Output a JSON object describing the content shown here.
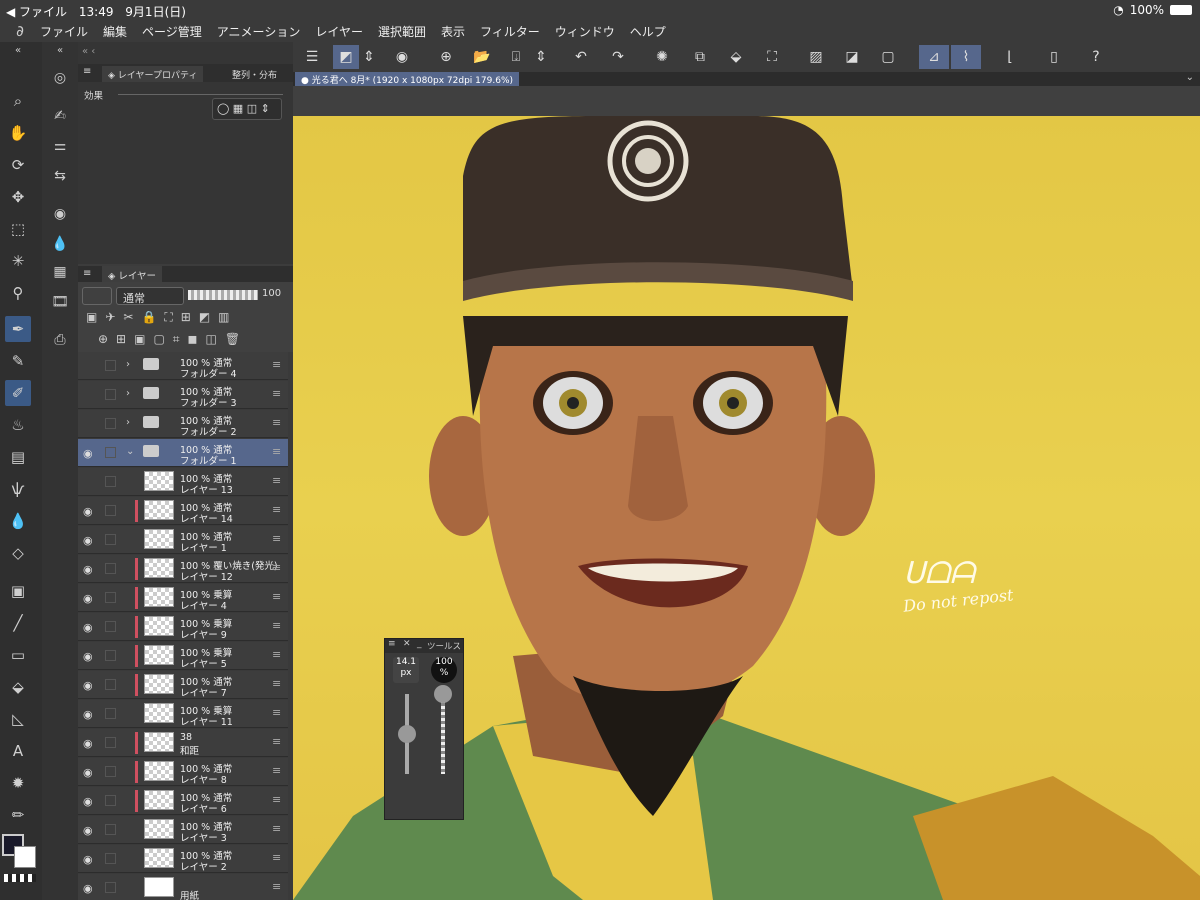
{
  "status": {
    "carrier": "◀ ファイル",
    "time": "13:49",
    "date": "9月1日(日)",
    "battery": "100%"
  },
  "menu": [
    "ファイル",
    "編集",
    "ページ管理",
    "アニメーション",
    "レイヤー",
    "選択範囲",
    "表示",
    "フィルター",
    "ウィンドウ",
    "ヘルプ"
  ],
  "property_panel": {
    "tab1": "レイヤープロパティ",
    "tab2": "整列・分布",
    "effect_label": "効果"
  },
  "layer_panel": {
    "tab": "レイヤー",
    "blend": "通常",
    "opacity": "100",
    "layers": [
      {
        "l1": "100 % 通常",
        "l2": "フォルダー 4",
        "type": "folder",
        "eye": false
      },
      {
        "l1": "100 % 通常",
        "l2": "フォルダー 3",
        "type": "folder",
        "eye": false
      },
      {
        "l1": "100 % 通常",
        "l2": "フォルダー 2",
        "type": "folder",
        "eye": false
      },
      {
        "l1": "100 % 通常",
        "l2": "フォルダー 1",
        "type": "folder",
        "eye": true,
        "selected": true
      },
      {
        "l1": "100 % 通常",
        "l2": "レイヤー 13",
        "type": "layer",
        "eye": false
      },
      {
        "l1": "100 % 通常",
        "l2": "レイヤー 14",
        "type": "layer",
        "eye": true,
        "bar": true
      },
      {
        "l1": "100 % 通常",
        "l2": "レイヤー 1",
        "type": "layer",
        "eye": true
      },
      {
        "l1": "100 % 覆い焼き(発光)",
        "l2": "レイヤー 12",
        "type": "layer",
        "eye": true,
        "bar": true
      },
      {
        "l1": "100 % 乗算",
        "l2": "レイヤー 4",
        "type": "layer",
        "eye": true,
        "bar": true
      },
      {
        "l1": "100 % 乗算",
        "l2": "レイヤー 9",
        "type": "layer",
        "eye": true,
        "bar": true
      },
      {
        "l1": "100 % 乗算",
        "l2": "レイヤー 5",
        "type": "layer",
        "eye": true,
        "bar": true
      },
      {
        "l1": "100 % 通常",
        "l2": "レイヤー 7",
        "type": "layer",
        "eye": true,
        "bar": true
      },
      {
        "l1": "100 % 乗算",
        "l2": "レイヤー 11",
        "type": "layer",
        "eye": true
      },
      {
        "l1": "38",
        "l2": "和距",
        "type": "mask",
        "eye": true,
        "bar": true
      },
      {
        "l1": "100 % 通常",
        "l2": "レイヤー 8",
        "type": "layer",
        "eye": true,
        "bar": true
      },
      {
        "l1": "100 % 通常",
        "l2": "レイヤー 6",
        "type": "layer",
        "eye": true,
        "bar": true
      },
      {
        "l1": "100 % 通常",
        "l2": "レイヤー 3",
        "type": "layer",
        "eye": true
      },
      {
        "l1": "100 % 通常",
        "l2": "レイヤー 2",
        "type": "layer",
        "eye": true
      },
      {
        "l1": "",
        "l2": "用紙",
        "type": "paper",
        "eye": true
      }
    ]
  },
  "document_tab": "光る君へ 8月* (1920 x 1080px 72dpi 179.6%)",
  "tool_panel": {
    "title": "ツールス",
    "size": "14.1",
    "size_unit": "px",
    "opacity": "100",
    "opacity_unit": "%"
  },
  "signature": {
    "line2": "Do not repost"
  }
}
